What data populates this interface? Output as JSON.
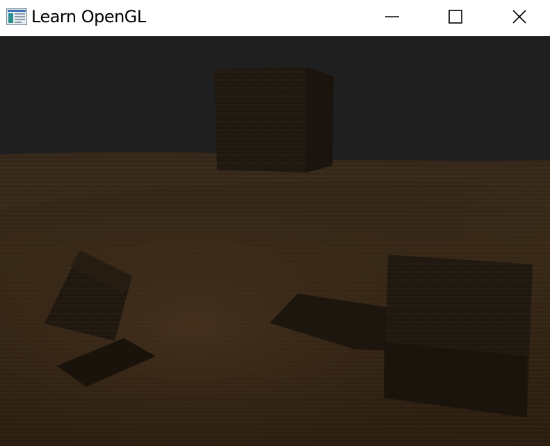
{
  "window": {
    "title": "Learn OpenGL",
    "app_icon": "opengl-window-icon",
    "controls": {
      "minimize_icon": "minimize-icon",
      "maximize_icon": "maximize-icon",
      "close_icon": "close-icon"
    }
  },
  "scene": {
    "clear_color": "#1f1f1f",
    "floor_color": "#3a2816",
    "crate_color": "#1e170f",
    "objects": [
      "floor-plane",
      "crate-back",
      "crate-left-tilted",
      "crate-left-flat",
      "crate-right-large",
      "crate-right-flat"
    ]
  }
}
